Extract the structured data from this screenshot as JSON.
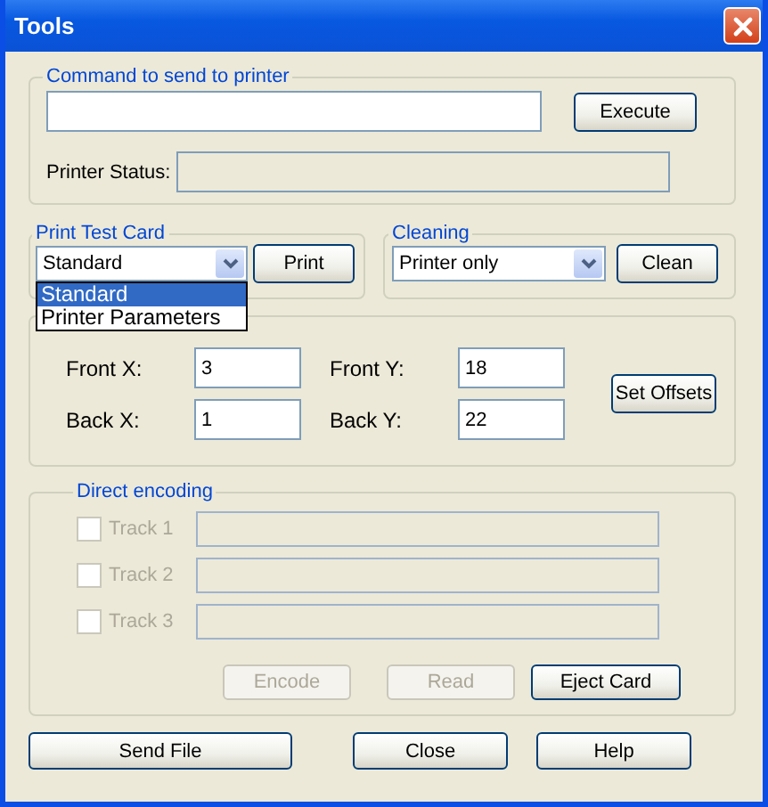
{
  "window": {
    "title": "Tools"
  },
  "command": {
    "label": "Command to send to printer",
    "execute": "Execute",
    "status_label": "Printer Status:"
  },
  "test_card": {
    "label": "Print Test Card",
    "value": "Standard",
    "button": "Print",
    "expanded": true,
    "options": [
      {
        "label": "Standard",
        "selected": true
      },
      {
        "label": "Printer Parameters",
        "selected": false
      }
    ]
  },
  "cleaning": {
    "label": "Cleaning",
    "value": "Printer only",
    "button": "Clean"
  },
  "offsets": {
    "fields": [
      {
        "label": "Front X:",
        "value": "3"
      },
      {
        "label": "Front Y:",
        "value": "18"
      },
      {
        "label": "Back X:",
        "value": "1"
      },
      {
        "label": "Back Y:",
        "value": "22"
      }
    ],
    "button": "Set Offsets"
  },
  "encoding": {
    "label": "Direct encoding",
    "disabled": true,
    "tracks": [
      {
        "label": "Track 1",
        "checked": false
      },
      {
        "label": "Track 2",
        "checked": false
      },
      {
        "label": "Track 3",
        "checked": false
      }
    ],
    "buttons": [
      {
        "label": "Encode",
        "disabled": true
      },
      {
        "label": "Read",
        "disabled": true
      },
      {
        "label": "Eject Card",
        "disabled": false
      }
    ]
  },
  "buttons": [
    "Send File",
    "Close",
    "Help"
  ]
}
